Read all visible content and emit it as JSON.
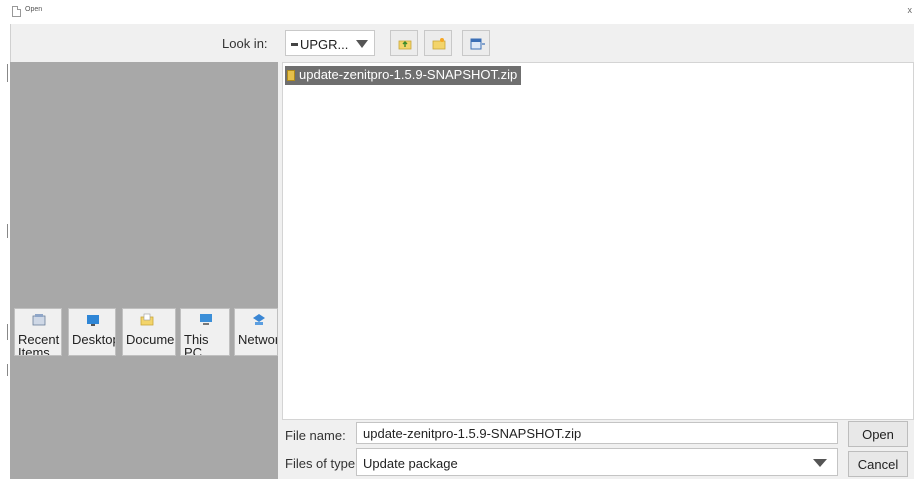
{
  "window": {
    "title": "Open",
    "close_glyph": "x"
  },
  "toolbar": {
    "lookin_label": "Look in:",
    "lookin_value": "UPGR...",
    "buttons": [
      {
        "name": "up-one-level-button",
        "icon": "folder-up-icon"
      },
      {
        "name": "create-new-folder-button",
        "icon": "new-folder-icon"
      },
      {
        "name": "view-menu-button",
        "icon": "view-menu-icon"
      }
    ]
  },
  "places": [
    {
      "label": "Recent Items",
      "icon": "recent-items-icon"
    },
    {
      "label": "Desktop",
      "icon": "desktop-icon"
    },
    {
      "label": "Documents",
      "icon": "documents-icon"
    },
    {
      "label": "This PC",
      "icon": "this-pc-icon"
    },
    {
      "label": "Network",
      "icon": "network-icon"
    }
  ],
  "files": [
    {
      "name": "update-zenitpro-1.5.9-SNAPSHOT.zip",
      "selected": true,
      "icon": "zip-file-icon"
    }
  ],
  "form": {
    "file_name_label": "File name:",
    "file_name_value": "update-zenitpro-1.5.9-SNAPSHOT.zip",
    "files_of_type_label": "Files of type:",
    "files_of_type_value": "Update package"
  },
  "actions": {
    "open_label": "Open",
    "cancel_label": "Cancel"
  },
  "colors": {
    "places_bg": "#a8a8a8",
    "selection_bg": "#6f6f6f",
    "dialog_bg": "#f0f0f0"
  }
}
